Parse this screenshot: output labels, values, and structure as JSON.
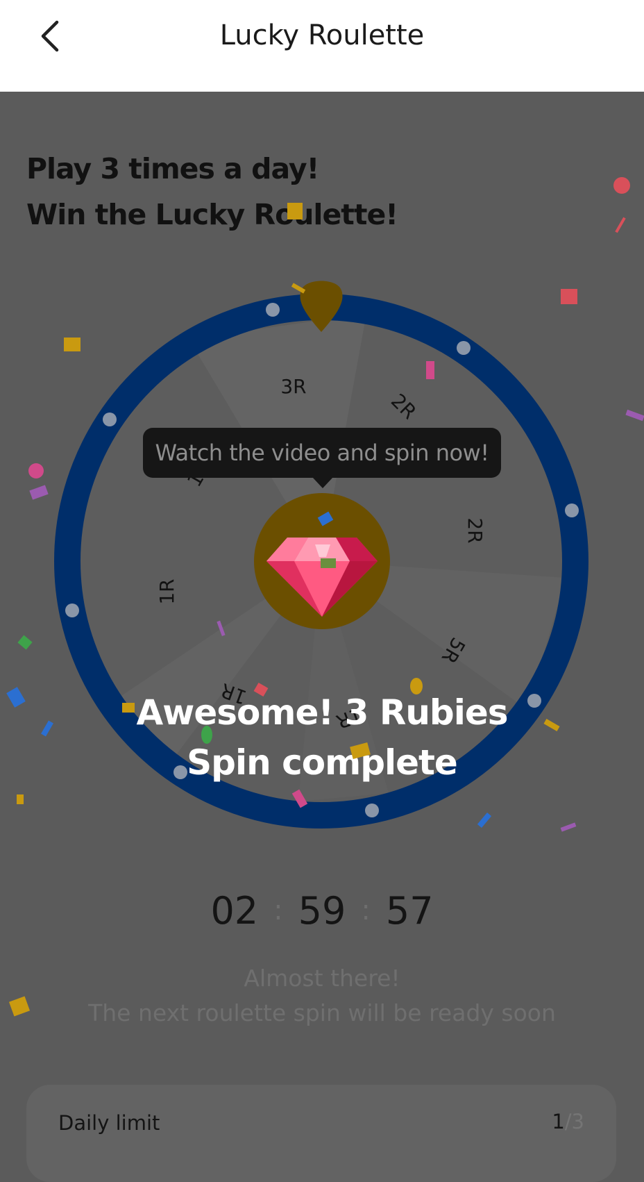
{
  "header": {
    "title": "Lucky Roulette",
    "back_icon": "chevron-left-icon"
  },
  "headline": {
    "line1": "Play 3 times a day!",
    "line2": "Win the Lucky Roulette!"
  },
  "wheel": {
    "segments": [
      "3R",
      "2R",
      "2R",
      "5R",
      "1R",
      "1R",
      "1R",
      "1R"
    ],
    "center_icon": "ruby-gem-icon",
    "pointer_icon": "pointer-icon",
    "ring_color": "#002e6a",
    "pointer_color": "#6b4f00"
  },
  "tooltip": {
    "text": "Watch the video and spin now!"
  },
  "result": {
    "line1": "Awesome! 3 Rubies",
    "line2": "Spin complete"
  },
  "timer": {
    "hours": "02",
    "minutes": "59",
    "seconds": "57",
    "separator": ":"
  },
  "message": {
    "line1": "Almost there!",
    "line2": "The next roulette spin will be ready soon"
  },
  "daily_limit": {
    "label": "Daily limit",
    "used": "1",
    "slash": "/",
    "total": "3"
  }
}
